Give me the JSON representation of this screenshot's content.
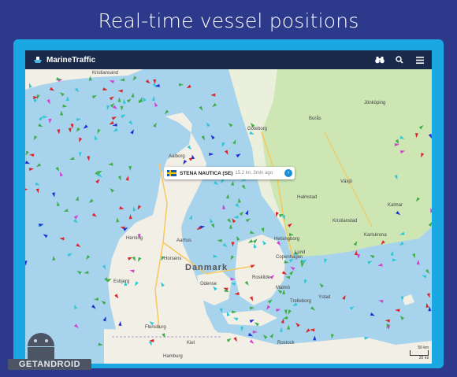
{
  "headline": "Real-time vessel positions",
  "app": {
    "name": "MarineTraffic"
  },
  "toolbar": {
    "binoculars_icon": "binoculars-icon",
    "search_icon": "search-icon",
    "menu_icon": "menu-icon"
  },
  "popup": {
    "vessel_name": "STENA NAUTICA (SE)",
    "info": "15.2 kn, 3min ago",
    "flag": "sweden-flag"
  },
  "map": {
    "country_label": "Danmark",
    "place_labels": [
      "Kristiansand",
      "Göteborg",
      "Borås",
      "Jönköping",
      "Halmstad",
      "Aalborg",
      "Aarhus",
      "Herning",
      "Horsens",
      "Esbjerg",
      "Helsingborg",
      "Malmö",
      "Copenhagen",
      "Lund",
      "Roskilde",
      "Kalmar",
      "Karlskrona",
      "Flensburg",
      "Kiel",
      "Odense",
      "Växjö",
      "Kristianstad",
      "Hamburg",
      "Rostock",
      "Trelleborg",
      "Ystad"
    ],
    "scale": [
      "50 km",
      "20 mi"
    ],
    "colors": {
      "land": "#f1efe6",
      "sweden_forest": "#cde6b4",
      "water": "#a8d3ec",
      "ship_red": "#d9262a",
      "ship_green": "#3fae49",
      "ship_blue": "#1f2fd1",
      "ship_cyan": "#2ec7d6",
      "ship_magenta": "#d43fd0"
    }
  },
  "watermark": {
    "text": "GETANDROID"
  }
}
